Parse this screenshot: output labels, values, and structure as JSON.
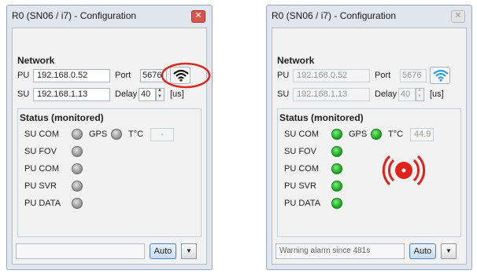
{
  "windows": [
    {
      "title": "R0 (SN06 / i7) - Configuration",
      "close_symbol": "✕",
      "network": {
        "heading": "Network",
        "pu_label": "PU",
        "pu_ip": "192.168.0.52",
        "port_label": "Port",
        "port_value": "5676",
        "su_label": "SU",
        "su_ip": "192.168.1.13",
        "delay_label": "Delay",
        "delay_value": "40",
        "unit": "[us]",
        "wifi_icon": "wifi-icon",
        "wifi_color": "#111111",
        "enabled": true
      },
      "status": {
        "heading": "Status (monitored)",
        "su_com": "SU COM",
        "gps": "GPS",
        "temp_label": "T°C",
        "temp_value": "-",
        "su_fov": "SU FOV",
        "pu_com": "PU COM",
        "pu_svr": "PU SVR",
        "pu_data": "PU DATA",
        "led_state": "off",
        "led_color": "#8c8c8c"
      },
      "bottom": {
        "status_text": "",
        "auto_label": "Auto",
        "dropdown_symbol": "▼"
      },
      "annotation": {
        "shape": "red-ellipse",
        "color": "#d62b24"
      }
    },
    {
      "title": "R0 (SN06 / i7) - Configuration",
      "close_symbol": "✕",
      "network": {
        "heading": "Network",
        "pu_label": "PU",
        "pu_ip": "192.168.0.52",
        "port_label": "Port",
        "port_value": "5676",
        "su_label": "SU",
        "su_ip": "192.168.1.13",
        "delay_label": "Delay",
        "delay_value": "40",
        "unit": "[us]",
        "wifi_icon": "wifi-icon",
        "wifi_color": "#2a9fd8",
        "enabled": false
      },
      "status": {
        "heading": "Status (monitored)",
        "su_com": "SU COM",
        "gps": "GPS",
        "temp_label": "T°C",
        "temp_value": "44.9",
        "su_fov": "SU FOV",
        "pu_com": "PU COM",
        "pu_svr": "PU SVR",
        "pu_data": "PU DATA",
        "led_state": "on",
        "led_color": "#1fae25",
        "alarm_icon": "alarm-icon",
        "alarm_color": "#e1221b"
      },
      "bottom": {
        "status_text": "Warning alarm since 481s",
        "auto_label": "Auto",
        "dropdown_symbol": "▼"
      }
    }
  ]
}
